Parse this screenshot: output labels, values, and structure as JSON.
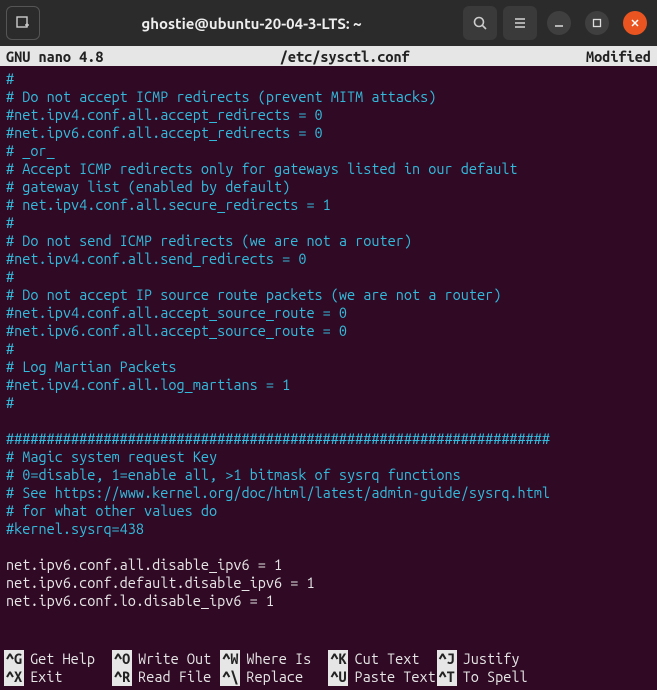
{
  "titlebar": {
    "title": "ghostie@ubuntu-20-04-3-LTS: ~"
  },
  "status": {
    "app": "GNU nano 4.8",
    "file": "/etc/sysctl.conf",
    "state": "Modified"
  },
  "lines": [
    {
      "cls": "comment",
      "text": "#"
    },
    {
      "cls": "comment",
      "text": "# Do not accept ICMP redirects (prevent MITM attacks)"
    },
    {
      "cls": "comment",
      "text": "#net.ipv4.conf.all.accept_redirects = 0"
    },
    {
      "cls": "comment",
      "text": "#net.ipv6.conf.all.accept_redirects = 0"
    },
    {
      "cls": "comment",
      "text": "# _or_"
    },
    {
      "cls": "comment",
      "text": "# Accept ICMP redirects only for gateways listed in our default"
    },
    {
      "cls": "comment",
      "text": "# gateway list (enabled by default)"
    },
    {
      "cls": "comment",
      "text": "# net.ipv4.conf.all.secure_redirects = 1"
    },
    {
      "cls": "comment",
      "text": "#"
    },
    {
      "cls": "comment",
      "text": "# Do not send ICMP redirects (we are not a router)"
    },
    {
      "cls": "comment",
      "text": "#net.ipv4.conf.all.send_redirects = 0"
    },
    {
      "cls": "comment",
      "text": "#"
    },
    {
      "cls": "comment",
      "text": "# Do not accept IP source route packets (we are not a router)"
    },
    {
      "cls": "comment",
      "text": "#net.ipv4.conf.all.accept_source_route = 0"
    },
    {
      "cls": "comment",
      "text": "#net.ipv6.conf.all.accept_source_route = 0"
    },
    {
      "cls": "comment",
      "text": "#"
    },
    {
      "cls": "comment",
      "text": "# Log Martian Packets"
    },
    {
      "cls": "comment",
      "text": "#net.ipv4.conf.all.log_martians = 1"
    },
    {
      "cls": "comment",
      "text": "#"
    },
    {
      "cls": "plain",
      "text": ""
    },
    {
      "cls": "comment",
      "text": "###################################################################"
    },
    {
      "cls": "comment",
      "text": "# Magic system request Key"
    },
    {
      "cls": "comment",
      "text": "# 0=disable, 1=enable all, >1 bitmask of sysrq functions"
    },
    {
      "cls": "comment",
      "text": "# See https://www.kernel.org/doc/html/latest/admin-guide/sysrq.html"
    },
    {
      "cls": "comment",
      "text": "# for what other values do"
    },
    {
      "cls": "comment",
      "text": "#kernel.sysrq=438"
    },
    {
      "cls": "plain",
      "text": ""
    },
    {
      "cls": "plain",
      "text": "net.ipv6.conf.all.disable_ipv6 = 1"
    },
    {
      "cls": "plain",
      "text": "net.ipv6.conf.default.disable_ipv6 = 1"
    },
    {
      "cls": "plain",
      "text": "net.ipv6.conf.lo.disable_ipv6 = 1"
    }
  ],
  "shortcuts": [
    {
      "key": "^G",
      "label": "Get Help"
    },
    {
      "key": "^O",
      "label": "Write Out"
    },
    {
      "key": "^W",
      "label": "Where Is"
    },
    {
      "key": "^K",
      "label": "Cut Text"
    },
    {
      "key": "^J",
      "label": "Justify"
    },
    {
      "key": "^X",
      "label": "Exit"
    },
    {
      "key": "^R",
      "label": "Read File"
    },
    {
      "key": "^\\",
      "label": "Replace"
    },
    {
      "key": "^U",
      "label": "Paste Text"
    },
    {
      "key": "^T",
      "label": "To Spell"
    }
  ]
}
